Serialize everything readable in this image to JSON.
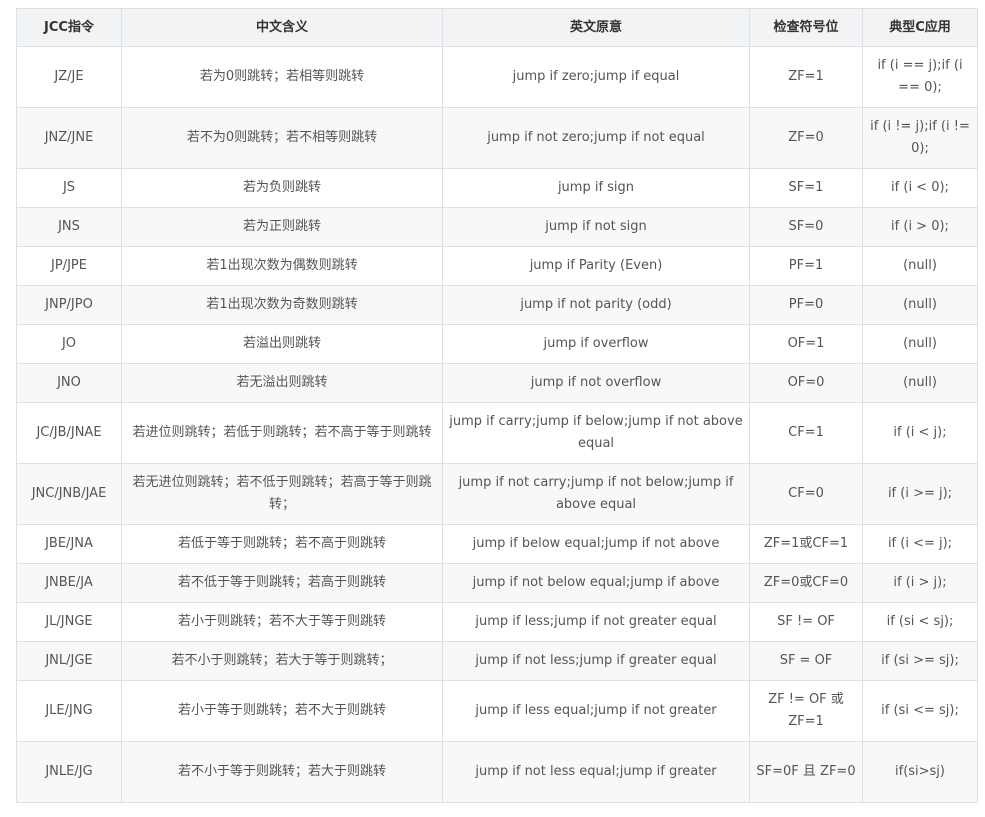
{
  "table": {
    "headers": [
      "JCC指令",
      "中文含义",
      "英文原意",
      "检查符号位",
      "典型C应用"
    ],
    "rows": [
      [
        "JZ/JE",
        "若为0则跳转；若相等则跳转",
        "jump if zero;jump if equal",
        "ZF=1",
        "if (i == j);if (i == 0);"
      ],
      [
        "JNZ/JNE",
        "若不为0则跳转；若不相等则跳转",
        "jump if not zero;jump if not equal",
        "ZF=0",
        "if (i != j);if (i != 0);"
      ],
      [
        "JS",
        "若为负则跳转",
        "jump if sign",
        "SF=1",
        "if (i < 0);"
      ],
      [
        "JNS",
        "若为正则跳转",
        "jump if not sign",
        "SF=0",
        "if (i > 0);"
      ],
      [
        "JP/JPE",
        "若1出现次数为偶数则跳转",
        "jump if Parity (Even)",
        "PF=1",
        "(null)"
      ],
      [
        "JNP/JPO",
        "若1出现次数为奇数则跳转",
        "jump if not parity (odd)",
        "PF=0",
        "(null)"
      ],
      [
        "JO",
        "若溢出则跳转",
        "jump if overflow",
        "OF=1",
        "(null)"
      ],
      [
        "JNO",
        "若无溢出则跳转",
        "jump if not overflow",
        "OF=0",
        "(null)"
      ],
      [
        "JC/JB/JNAE",
        "若进位则跳转；若低于则跳转；若不高于等于则跳转",
        "jump if carry;jump if below;jump if not above equal",
        "CF=1",
        "if (i < j);"
      ],
      [
        "JNC/JNB/JAE",
        "若无进位则跳转；若不低于则跳转；若高于等于则跳转；",
        "jump if not carry;jump if not below;jump if above equal",
        "CF=0",
        "if (i >= j);"
      ],
      [
        "JBE/JNA",
        "若低于等于则跳转；若不高于则跳转",
        "jump if below equal;jump if not above",
        "ZF=1或CF=1",
        "if (i <= j);"
      ],
      [
        "JNBE/JA",
        "若不低于等于则跳转；若高于则跳转",
        "jump if not below equal;jump if above",
        "ZF=0或CF=0",
        "if (i > j);"
      ],
      [
        "JL/JNGE",
        "若小于则跳转；若不大于等于则跳转",
        "jump if less;jump if not greater equal",
        "SF != OF",
        "if (si < sj);"
      ],
      [
        "JNL/JGE",
        "若不小于则跳转；若大于等于则跳转；",
        "jump if not less;jump if greater equal",
        "SF = OF",
        "if (si >= sj);"
      ],
      [
        "JLE/JNG",
        "若小于等于则跳转；若不大于则跳转",
        "jump if less equal;jump if not greater",
        "ZF != OF 或 ZF=1",
        "if (si <= sj);"
      ],
      [
        "JNLE/JG",
        "若不小于等于则跳转；若大于则跳转",
        "jump if not less equal;jump if greater",
        "SF=0F 且 ZF=0",
        "if(si>sj)"
      ]
    ]
  }
}
